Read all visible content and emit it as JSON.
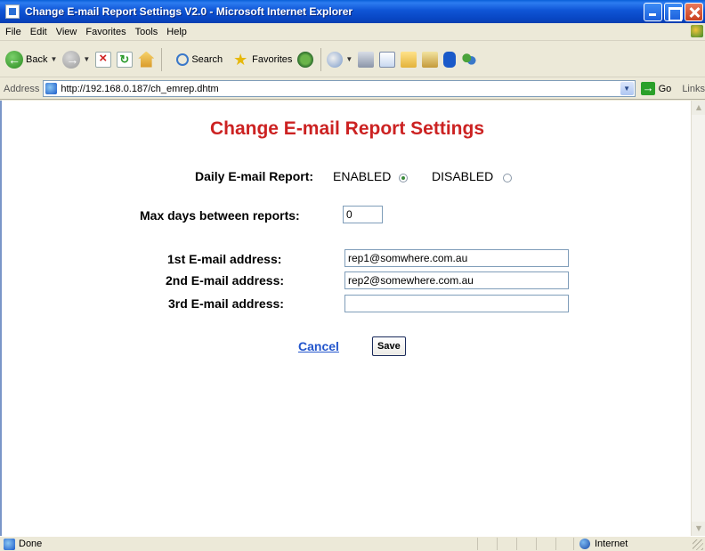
{
  "window": {
    "title": "Change E-mail Report Settings V2.0 - Microsoft Internet Explorer"
  },
  "menubar": {
    "items": [
      "File",
      "Edit",
      "View",
      "Favorites",
      "Tools",
      "Help"
    ]
  },
  "toolbar": {
    "back_label": "Back",
    "search_label": "Search",
    "favorites_label": "Favorites",
    "icons": [
      "back-icon",
      "forward-icon",
      "stop-icon",
      "refresh-icon",
      "home-icon",
      "search-icon",
      "favorites-star-icon",
      "media-icon",
      "mail-icon",
      "print-icon",
      "edit-icon",
      "folder-icon",
      "research-icon",
      "bluetooth-icon",
      "messenger-icon"
    ]
  },
  "addressbar": {
    "label": "Address",
    "url": "http://192.168.0.187/ch_emrep.dhtm",
    "go_label": "Go",
    "links_label": "Links"
  },
  "page": {
    "title": "Change E-mail Report Settings",
    "daily_report": {
      "label": "Daily E-mail Report:",
      "enabled_label": "ENABLED",
      "disabled_label": "DISABLED",
      "selected": "ENABLED"
    },
    "max_days": {
      "label": "Max days between reports:",
      "value": "0"
    },
    "emails": [
      {
        "label": "1st E-mail address:",
        "value": "rep1@somwhere.com.au"
      },
      {
        "label": "2nd E-mail address:",
        "value": "rep2@somewhere.com.au"
      },
      {
        "label": "3rd E-mail address:",
        "value": ""
      }
    ],
    "cancel_label": "Cancel",
    "save_label": "Save"
  },
  "statusbar": {
    "status": "Done",
    "zone": "Internet"
  },
  "colors": {
    "title_red": "#cc2222",
    "link_blue": "#2255cc",
    "xp_blue": "#0a5fd8",
    "chrome": "#ece9d8"
  }
}
